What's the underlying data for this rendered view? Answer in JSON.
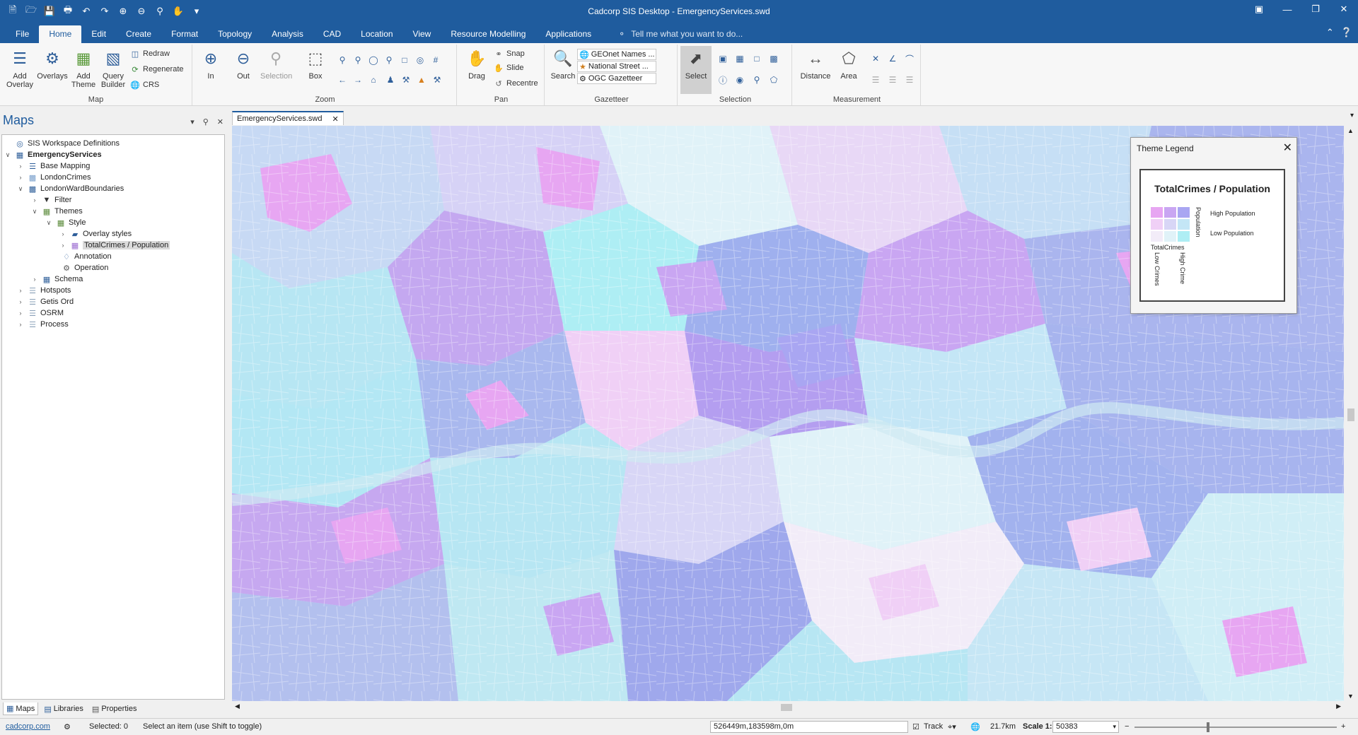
{
  "window": {
    "title": "Cadcorp SIS Desktop - EmergencyServices.swd"
  },
  "ribbon_tabs": [
    "File",
    "Home",
    "Edit",
    "Create",
    "Format",
    "Topology",
    "Analysis",
    "CAD",
    "Location",
    "View",
    "Resource Modelling",
    "Applications"
  ],
  "tell_me": "Tell me what you want to do...",
  "ribbon": {
    "map": {
      "label": "Map",
      "add_overlay": "Add Overlay",
      "overlays": "Overlays",
      "add_theme": "Add Theme",
      "query_builder": "Query Builder",
      "redraw": "Redraw",
      "regenerate": "Regenerate",
      "crs": "CRS"
    },
    "zoom": {
      "label": "Zoom",
      "in": "In",
      "out": "Out",
      "selection": "Selection",
      "box": "Box"
    },
    "pan": {
      "label": "Pan",
      "drag": "Drag",
      "snap": "Snap",
      "slide": "Slide",
      "recentre": "Recentre"
    },
    "gazetteer": {
      "label": "Gazetteer",
      "search": "Search",
      "items": [
        "GEOnet Names ...",
        "National Street ...",
        "OGC Gazetteer"
      ]
    },
    "selection": {
      "label": "Selection",
      "select": "Select"
    },
    "measurement": {
      "label": "Measurement",
      "distance": "Distance",
      "area": "Area"
    }
  },
  "maps_pane": {
    "title": "Maps",
    "tree": [
      {
        "label": "SIS Workspace Definitions"
      },
      {
        "label": "EmergencyServices"
      },
      {
        "label": "Base Mapping"
      },
      {
        "label": "LondonCrimes"
      },
      {
        "label": "LondonWardBoundaries"
      },
      {
        "label": "Filter"
      },
      {
        "label": "Themes"
      },
      {
        "label": "Style"
      },
      {
        "label": "Overlay styles"
      },
      {
        "label": "TotalCrimes / Population"
      },
      {
        "label": "Annotation"
      },
      {
        "label": "Operation"
      },
      {
        "label": "Schema"
      },
      {
        "label": "Hotspots"
      },
      {
        "label": "Getis Ord"
      },
      {
        "label": "OSRM"
      },
      {
        "label": "Process"
      }
    ],
    "tabs": [
      "Maps",
      "Libraries",
      "Properties"
    ]
  },
  "document_tab": "EmergencyServices.swd",
  "legend": {
    "window_title": "Theme Legend",
    "title": "TotalCrimes / Population",
    "high_population": "High Population",
    "low_population": "Low Population",
    "population_axis": "Population",
    "totalcrimes_axis": "TotalCrimes",
    "low_crimes": "Low Crimes",
    "high_crime": "High Crime",
    "colors": [
      "#e7a6f2",
      "#c9a6f2",
      "#a9a6f2",
      "#f0d0f6",
      "#d8d6f6",
      "#c4e6f6",
      "#f2ecf8",
      "#e0f2f8",
      "#aeeef4"
    ]
  },
  "status": {
    "link": "cadcorp.com",
    "selected": "Selected: 0",
    "hint": "Select an item (use Shift to toggle)",
    "coords": "526449m,183598m,0m",
    "track": "Track",
    "distance": "21.7km",
    "scale_label": "Scale 1:",
    "scale_value": "50383"
  }
}
